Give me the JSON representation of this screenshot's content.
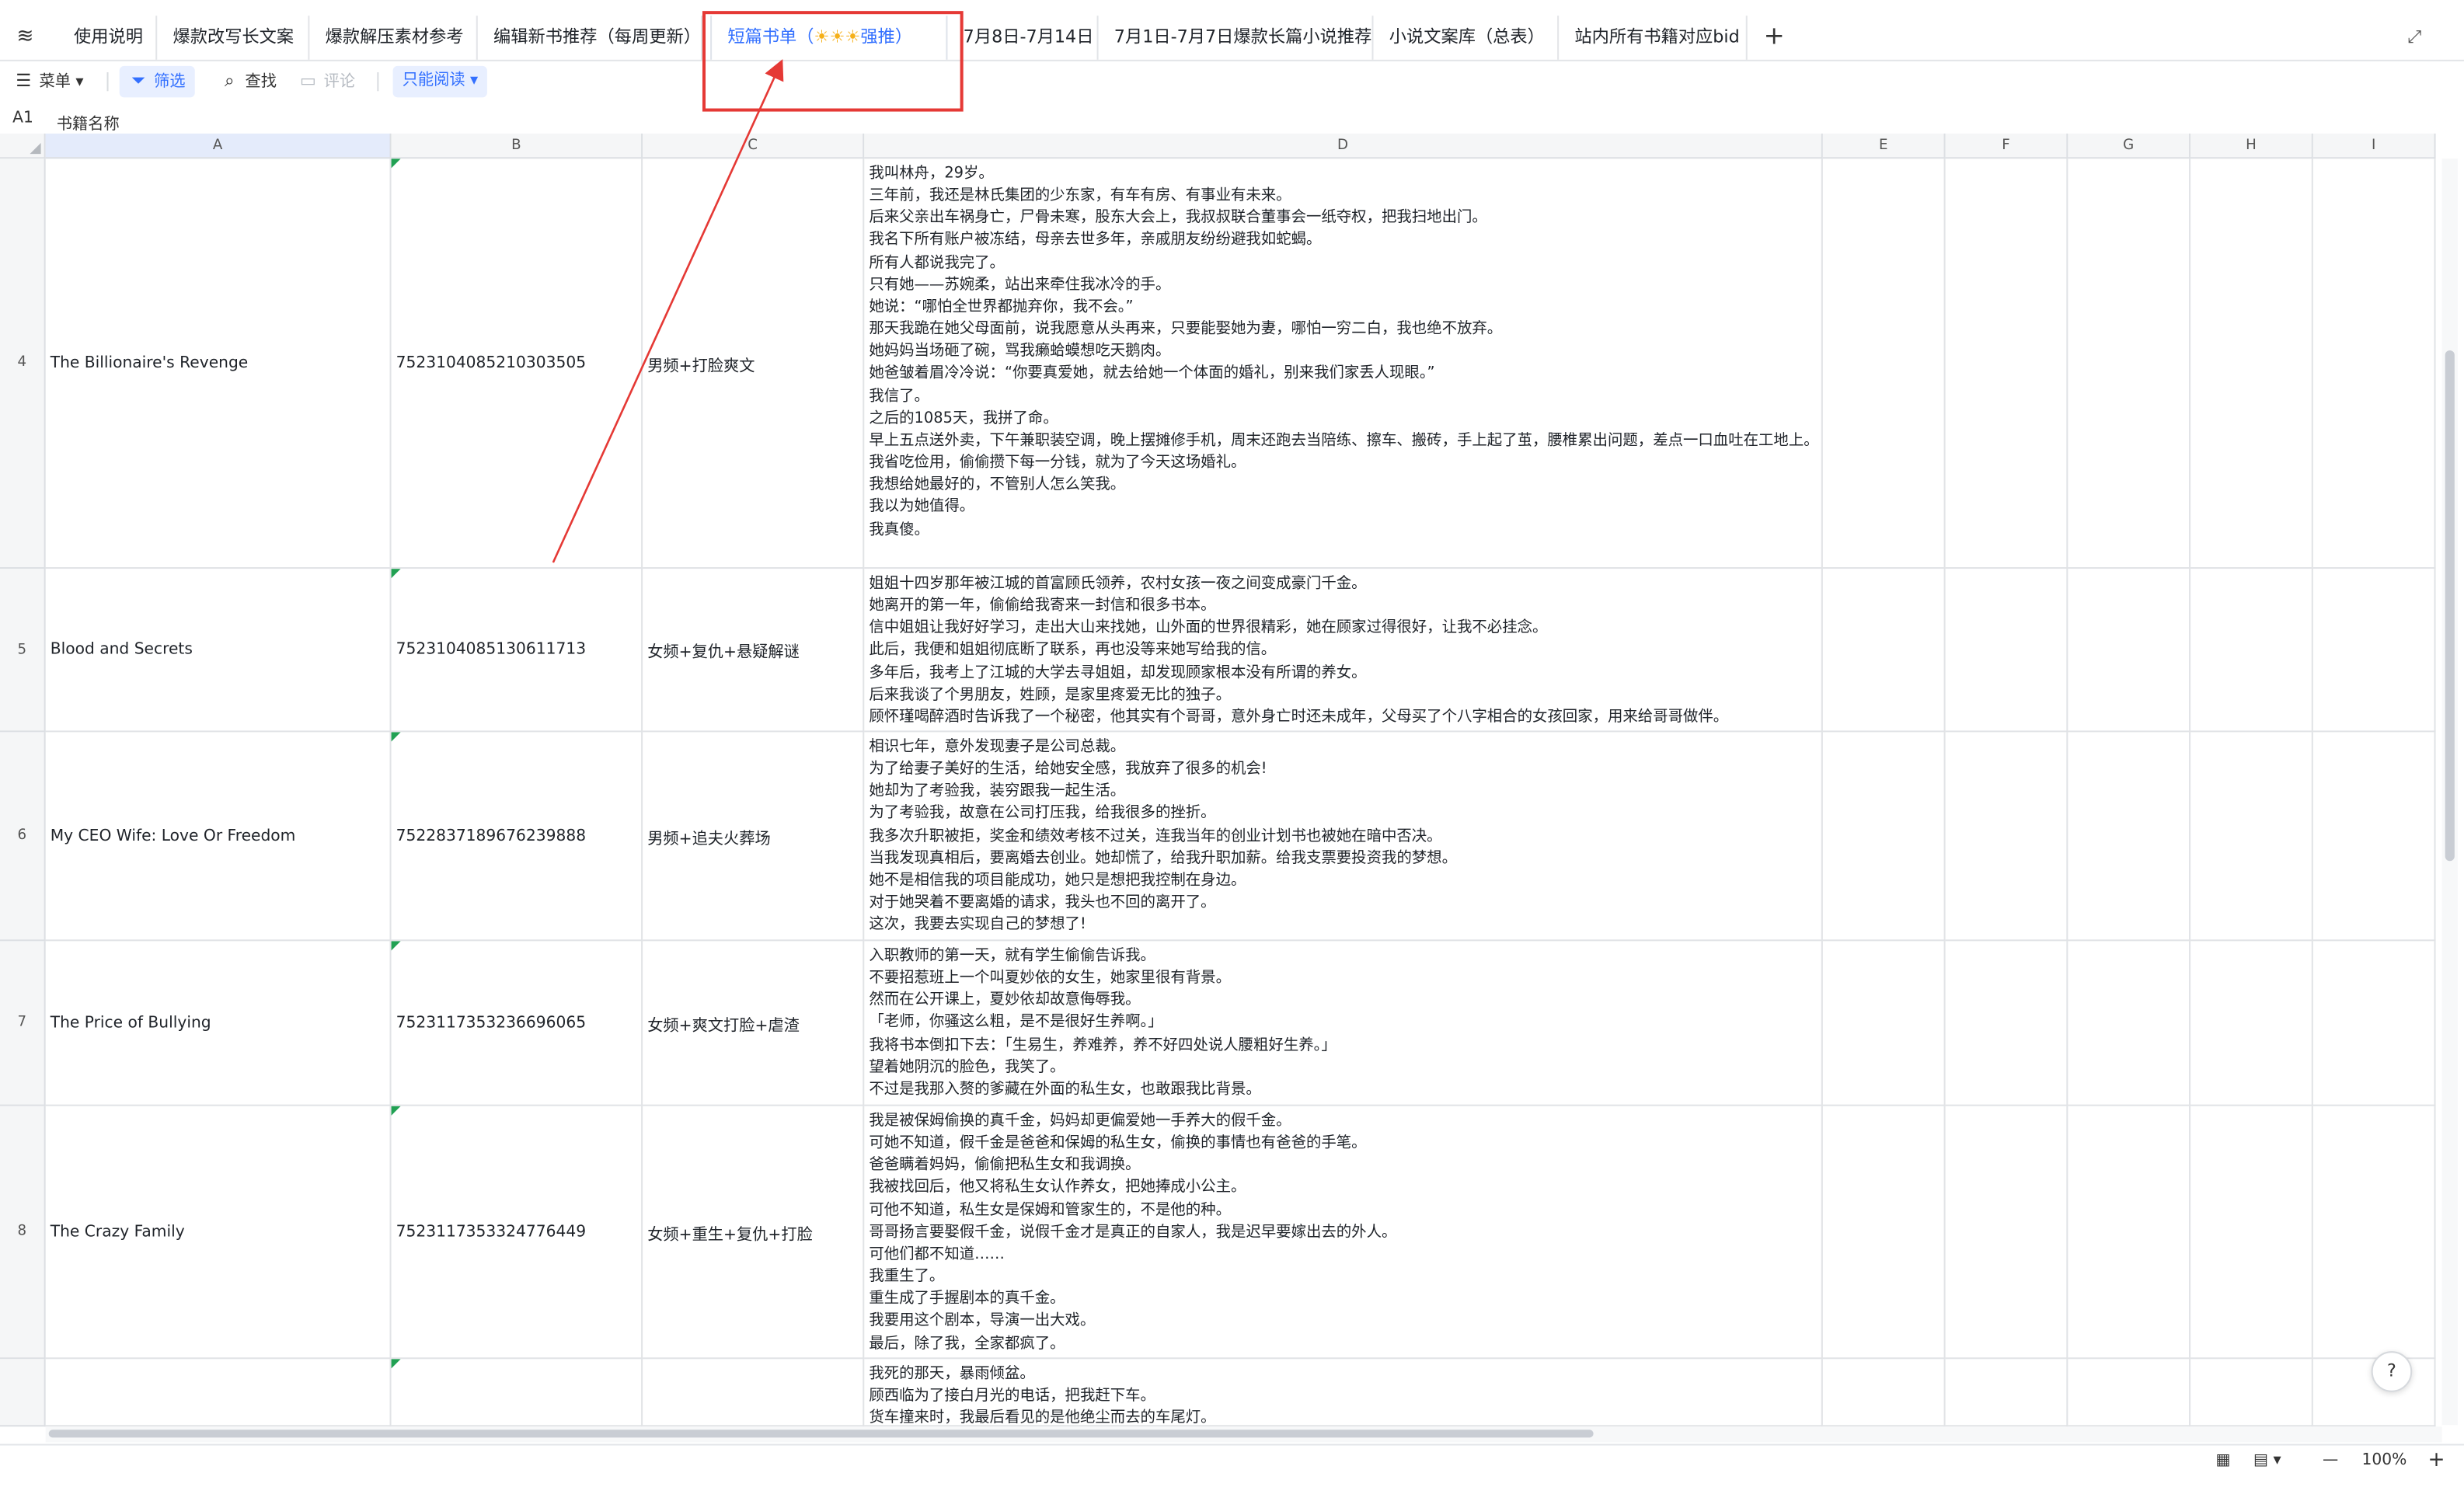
{
  "tabs": [
    {
      "label": "使用说明"
    },
    {
      "label": "爆款改写长文案"
    },
    {
      "label": "爆款解压素材参考"
    },
    {
      "label": "编辑新书推荐（每周更新）"
    },
    {
      "label_pre": "短篇书单（",
      "label_sun": "☀☀☀",
      "label_post": "强推）"
    },
    {
      "label": "7月8日-7月14日"
    },
    {
      "label": "7月1日-7月7日爆款长篇小说推荐"
    },
    {
      "label": "小说文案库（总表）"
    },
    {
      "label": "站内所有书籍对应bid"
    }
  ],
  "toolbar": {
    "menu": "菜单",
    "filter": "筛选",
    "find": "查找",
    "comment": "评论",
    "readonly": "只能阅读"
  },
  "formula": {
    "ref": "A1",
    "value": "书籍名称"
  },
  "columns": [
    "A",
    "B",
    "C",
    "D",
    "E",
    "F",
    "G",
    "H",
    "I"
  ],
  "rows": [
    {
      "num": "4",
      "title": "The Billionaire's Revenge",
      "bid": "7523104085210303505",
      "tag": "男频+打脸爽文",
      "desc": "我叫林舟，29岁。\n三年前，我还是林氏集团的少东家，有车有房、有事业有未来。\n后来父亲出车祸身亡，尸骨未寒，股东大会上，我叔叔联合董事会一纸夺权，把我扫地出门。\n我名下所有账户被冻结，母亲去世多年，亲戚朋友纷纷避我如蛇蝎。\n所有人都说我完了。\n只有她——苏婉柔，站出来牵住我冰冷的手。\n她说：“哪怕全世界都抛弃你，我不会。”\n那天我跪在她父母面前，说我愿意从头再来，只要能娶她为妻，哪怕一穷二白，我也绝不放弃。\n她妈妈当场砸了碗，骂我癞蛤蟆想吃天鹅肉。\n她爸皱着眉冷冷说：“你要真爱她，就去给她一个体面的婚礼，别来我们家丢人现眼。”\n我信了。\n之后的1085天，我拼了命。\n早上五点送外卖，下午兼职装空调，晚上摆摊修手机，周末还跑去当陪练、擦车、搬砖，手上起了茧，腰椎累出问题，差点一口血吐在工地上。\n我省吃俭用，偷偷攒下每一分钱，就为了今天这场婚礼。\n我想给她最好的，不管别人怎么笑我。\n我以为她值得。\n我真傻。"
    },
    {
      "num": "5",
      "title": "Blood and Secrets",
      "bid": "7523104085130611713",
      "tag": "女频+复仇+悬疑解谜",
      "desc": "姐姐十四岁那年被江城的首富顾氏领养，农村女孩一夜之间变成豪门千金。\n她离开的第一年，偷偷给我寄来一封信和很多书本。\n信中姐姐让我好好学习，走出大山来找她，山外面的世界很精彩，她在顾家过得很好，让我不必挂念。\n此后，我便和姐姐彻底断了联系，再也没等来她写给我的信。\n多年后，我考上了江城的大学去寻姐姐，却发现顾家根本没有所谓的养女。\n后来我谈了个男朋友，姓顾，是家里疼爱无比的独子。\n顾怀瑾喝醉酒时告诉我了一个秘密，他其实有个哥哥，意外身亡时还未成年，父母买了个八字相合的女孩回家，用来给哥哥做伴。"
    },
    {
      "num": "6",
      "title": "My CEO Wife: Love Or Freedom",
      "bid": "7522837189676239888",
      "tag": "男频+追夫火葬场",
      "desc": "相识七年，意外发现妻子是公司总裁。\n为了给妻子美好的生活，给她安全感，我放弃了很多的机会!\n她却为了考验我，装穷跟我一起生活。\n为了考验我，故意在公司打压我，给我很多的挫折。\n我多次升职被拒，奖金和绩效考核不过关，连我当年的创业计划书也被她在暗中否决。\n当我发现真相后，要离婚去创业。她却慌了，给我升职加薪。给我支票要投资我的梦想。\n她不是相信我的项目能成功，她只是想把我控制在身边。\n对于她哭着不要离婚的请求，我头也不回的离开了。\n这次，我要去实现自己的梦想了!"
    },
    {
      "num": "7",
      "title": "The Price of Bullying",
      "bid": "7523117353236696065",
      "tag": "女频+爽文打脸+虐渣",
      "desc": "入职教师的第一天，就有学生偷偷告诉我。\n不要招惹班上一个叫夏妙依的女生，她家里很有背景。\n然而在公开课上，夏妙依却故意侮辱我。\n「老师，你骚这么粗，是不是很好生养啊。」\n我将书本倒扣下去：「生易生，养难养，养不好四处说人腰粗好生养。」\n望着她阴沉的脸色，我笑了。\n不过是我那入赘的爹藏在外面的私生女，也敢跟我比背景。"
    },
    {
      "num": "8",
      "title": "The Crazy Family",
      "bid": "7523117353324776449",
      "tag": "女频+重生+复仇+打脸",
      "desc": "我是被保姆偷换的真千金，妈妈却更偏爱她一手养大的假千金。\n可她不知道，假千金是爸爸和保姆的私生女，偷换的事情也有爸爸的手笔。\n爸爸瞒着妈妈，偷偷把私生女和我调换。\n我被找回后，他又将私生女认作养女，把她捧成小公主。\n可他不知道，私生女是保姆和管家生的，不是他的种。\n哥哥扬言要娶假千金，说假千金才是真正的自家人，我是迟早要嫁出去的外人。\n可他们都不知道……\n我重生了。\n重生成了手握剧本的真千金。\n我要用这个剧本，导演一出大戏。\n最后，除了我，全家都疯了。"
    },
    {
      "num": "",
      "title": "",
      "bid": "",
      "tag": "",
      "desc": "我死的那天，暴雨倾盆。\n顾西临为了接白月光的电话，把我赶下车。\n货车撞来时，我最后看见的是他绝尘而去的车尾灯。"
    }
  ],
  "status": {
    "zoom": "100%",
    "minus": "—",
    "plus": "+"
  },
  "help": "?"
}
